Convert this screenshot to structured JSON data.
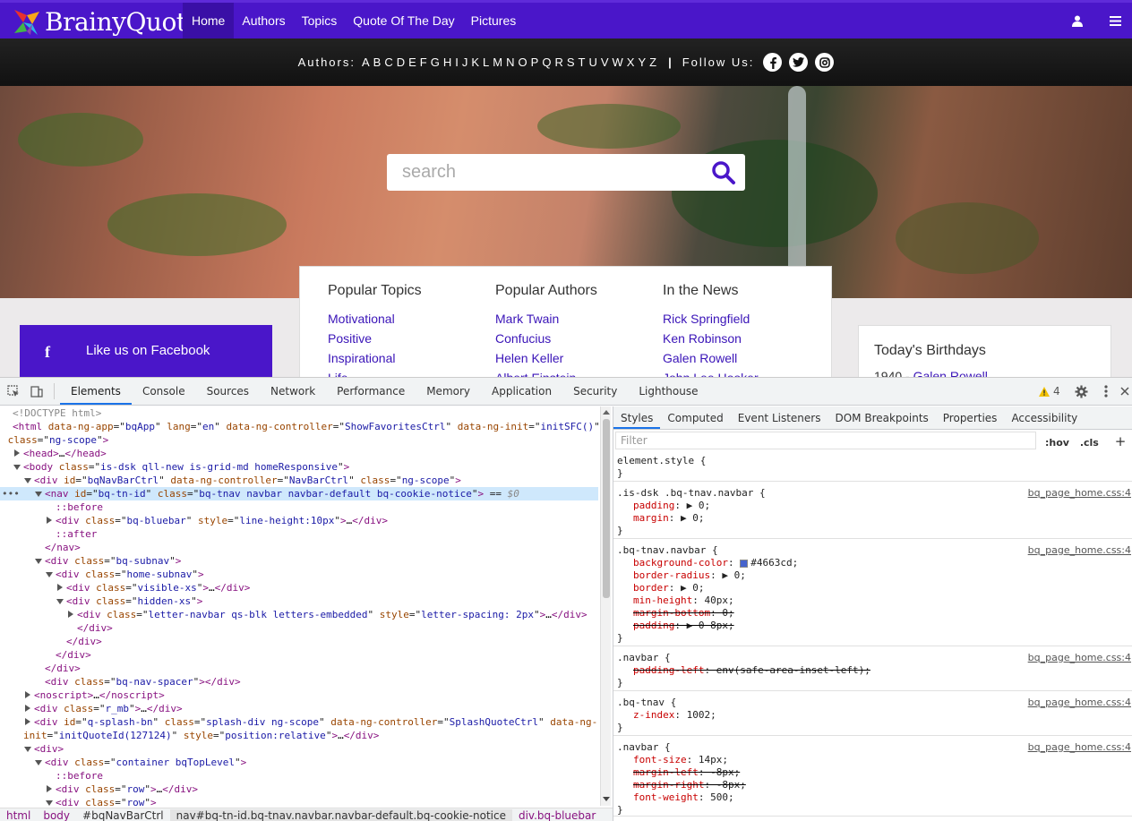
{
  "site": {
    "logo_text": "BrainyQuote",
    "nav": [
      "Home",
      "Authors",
      "Topics",
      "Quote Of The Day",
      "Pictures"
    ],
    "subnav_label": "Authors:",
    "letters": [
      "A",
      "B",
      "C",
      "D",
      "E",
      "F",
      "G",
      "H",
      "I",
      "J",
      "K",
      "L",
      "M",
      "N",
      "O",
      "P",
      "Q",
      "R",
      "S",
      "T",
      "U",
      "V",
      "W",
      "X",
      "Y",
      "Z"
    ],
    "follow_label": "Follow Us:",
    "search_placeholder": "search",
    "popular_topics": {
      "title": "Popular Topics",
      "items": [
        "Motivational",
        "Positive",
        "Inspirational",
        "Life"
      ]
    },
    "popular_authors": {
      "title": "Popular Authors",
      "items": [
        "Mark Twain",
        "Confucius",
        "Helen Keller",
        "Albert Einstein"
      ]
    },
    "in_the_news": {
      "title": "In the News",
      "items": [
        "Rick Springfield",
        "Ken Robinson",
        "Galen Rowell",
        "John Lee Hooker"
      ]
    },
    "facebook": {
      "icon": "f",
      "label": "Like us on Facebook"
    },
    "birthdays": {
      "title": "Today's Birthdays",
      "year": "1940 - ",
      "name": "Galen Rowell"
    },
    "colors": {
      "brand": "#4a16c9"
    }
  },
  "devtools": {
    "tabs": [
      "Elements",
      "Console",
      "Sources",
      "Network",
      "Performance",
      "Memory",
      "Application",
      "Security",
      "Lighthouse"
    ],
    "warnings": "4",
    "side_tabs": [
      "Styles",
      "Computed",
      "Event Listeners",
      "DOM Breakpoints",
      "Properties",
      "Accessibility"
    ],
    "filter_placeholder": "Filter",
    "filter_hov": ":hov",
    "filter_cls": ".cls",
    "breadcrumbs": [
      "html",
      "body",
      "#bqNavBarCtrl",
      "nav#bq-tn-id.bq-tnav.navbar.navbar-default.bq-cookie-notice",
      "div.bq-bluebar"
    ],
    "source_file": "bq_page_home.css:4"
  }
}
